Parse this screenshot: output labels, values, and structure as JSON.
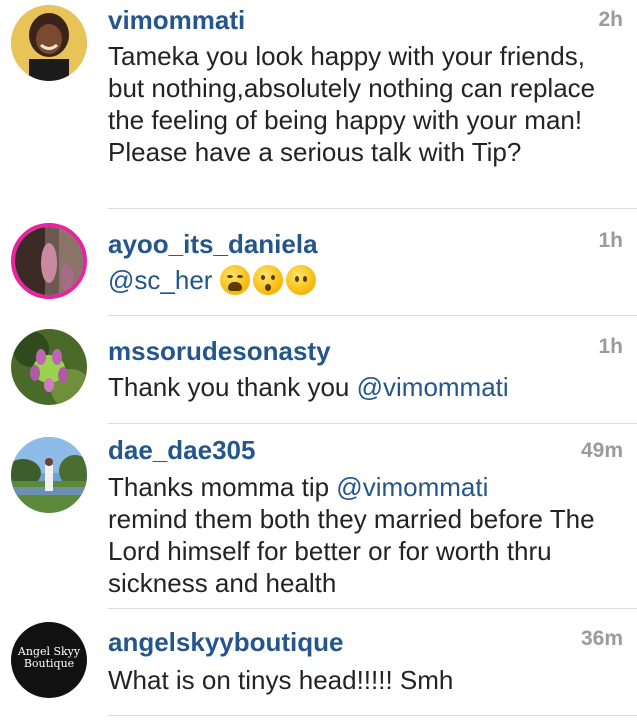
{
  "comments": [
    {
      "username": "vimommati",
      "time": "2h",
      "text": "Tameka you look happy with your friends, but nothing,absolutely nothing can replace the feeling of being happy with your man! Please have a serious talk with Tip?"
    },
    {
      "username": "ayoo_its_daniela",
      "time": "1h",
      "mention": "@sc_her",
      "emojis": [
        "weary-face-emoji",
        "hushed-face-emoji",
        "no-mouth-face-emoji"
      ]
    },
    {
      "username": "mssorudesonasty",
      "time": "1h",
      "text": "Thank you thank you ",
      "mention": "@vimommati"
    },
    {
      "username": "dae_dae305",
      "time": "49m",
      "text_before": "Thanks momma tip ",
      "mention": "@vimommati",
      "text_after": "remind them both they married before The Lord himself for better or for worth thru sickness and health"
    },
    {
      "username": "angelskyyboutique",
      "time": "36m",
      "avatar_text_line1": "Angel Skyy",
      "avatar_text_line2": "Boutique",
      "text": "What is on tinys head!!!!! Smh"
    }
  ]
}
